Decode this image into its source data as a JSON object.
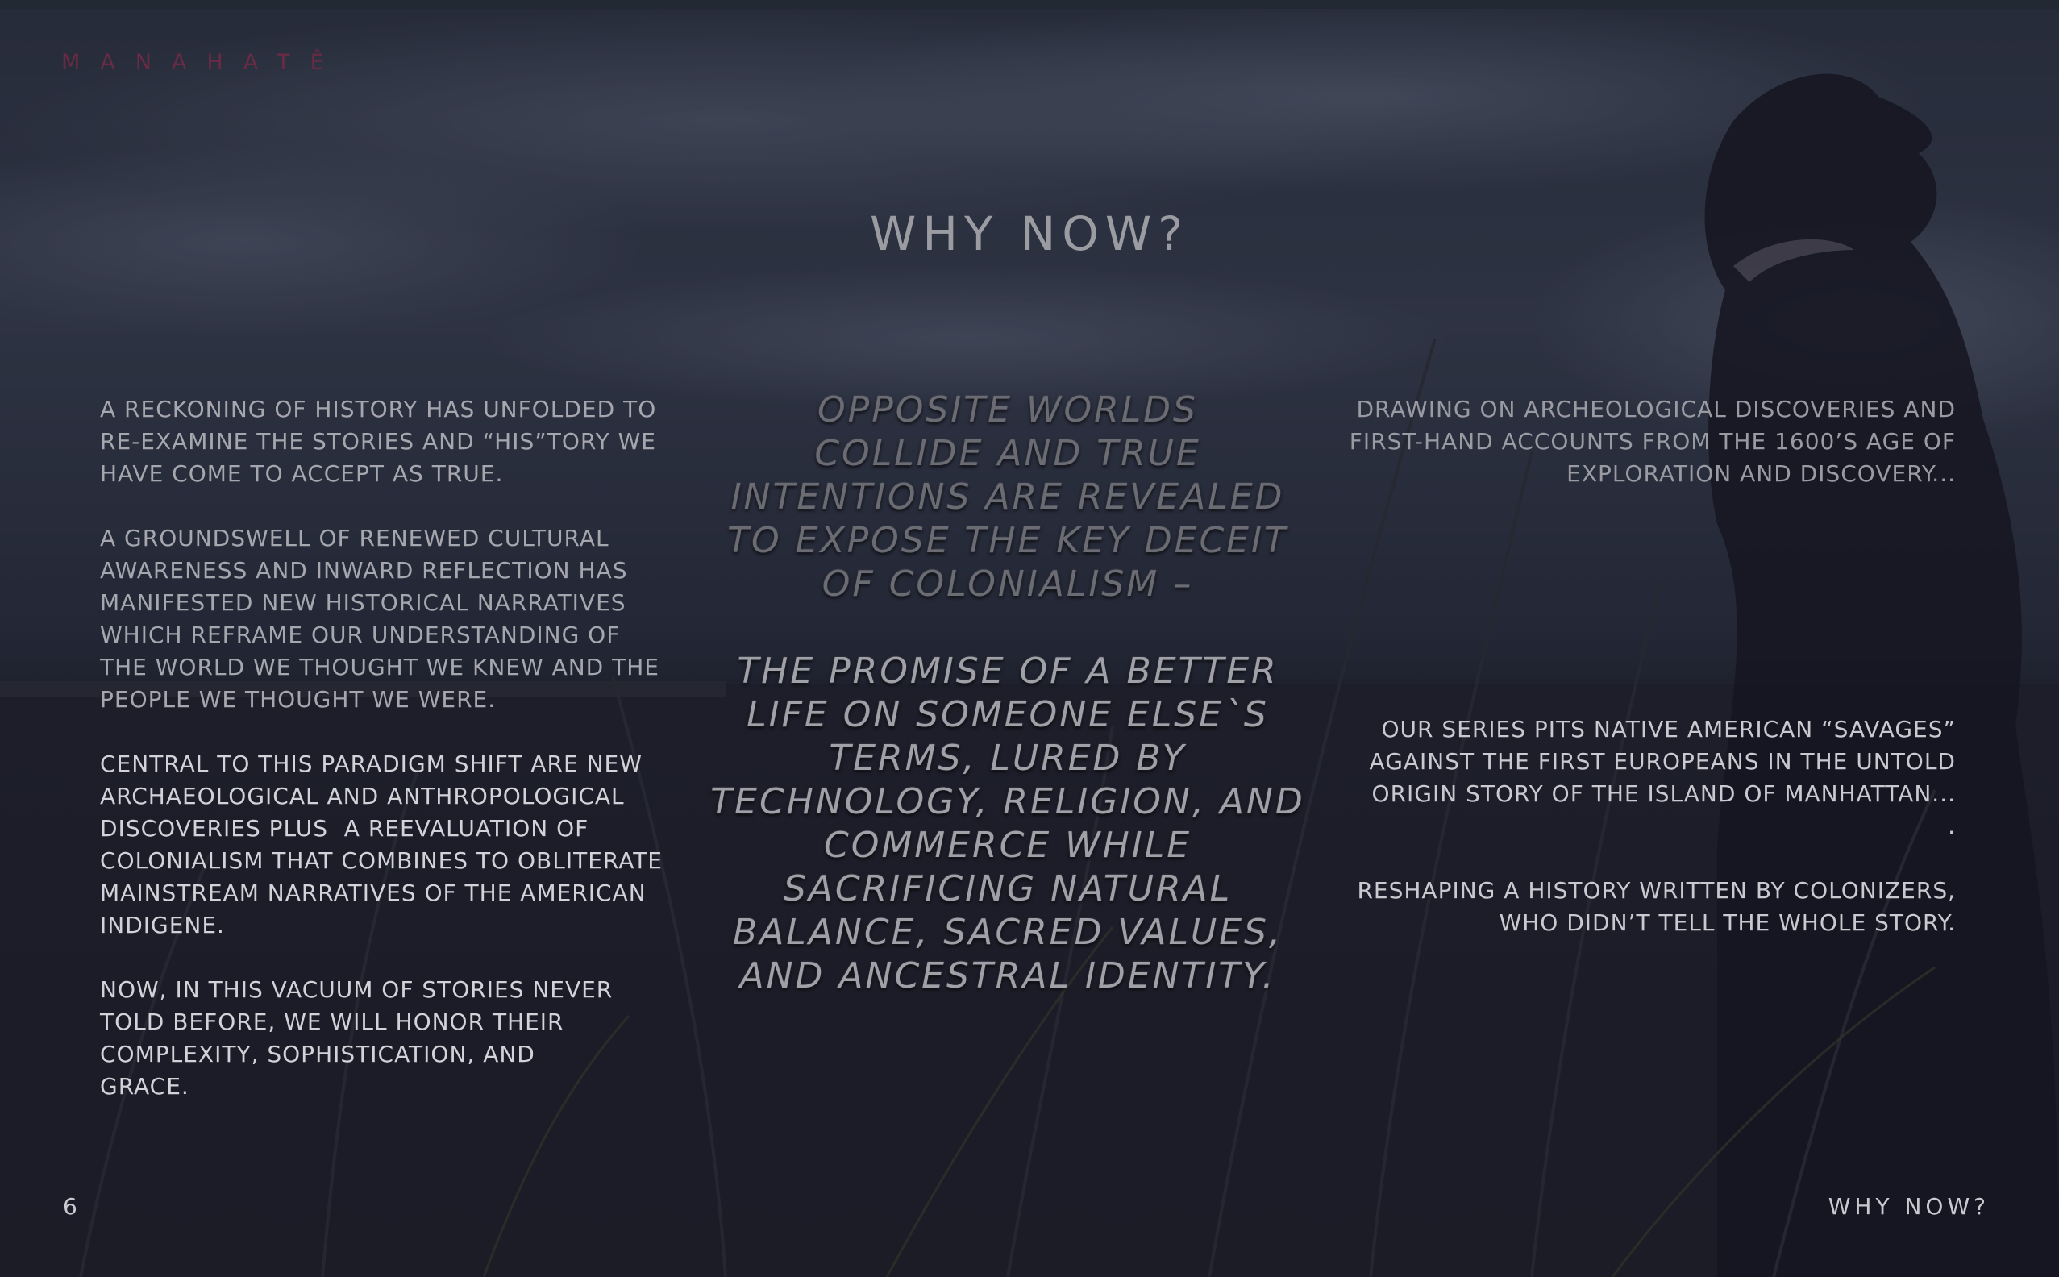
{
  "brand": {
    "name": "MANAHATÊ"
  },
  "page": {
    "title": "WHY NOW?",
    "number": "6",
    "footer_title": "WHY NOW?"
  },
  "left_column": {
    "paragraphs": [
      "A RECKONING OF HISTORY HAS UNFOLDED TO\nRE-EXAMINE THE STORIES AND “HIS”TORY WE\nHAVE COME TO ACCEPT AS TRUE.",
      "A GROUNDSWELL OF RENEWED CULTURAL\nAWARENESS AND INWARD REFLECTION HAS\nMANIFESTED NEW HISTORICAL NARRATIVES\nWHICH REFRAME OUR UNDERSTANDING OF\nTHE WORLD WE THOUGHT WE KNEW AND THE\nPEOPLE WE THOUGHT WE WERE.",
      "CENTRAL TO THIS PARADIGM SHIFT ARE NEW\nARCHAEOLOGICAL AND ANTHROPOLOGICAL\nDISCOVERIES PLUS  A REEVALUATION OF\nCOLONIALISM THAT COMBINES TO OBLITERATE\nMAINSTREAM NARRATIVES OF THE AMERICAN\nINDIGENE.",
      "NOW, IN THIS VACUUM OF STORIES NEVER\nTOLD BEFORE, WE WILL HONOR THEIR\nCOMPLEXITY, SOPHISTICATION, AND\nGRACE."
    ]
  },
  "center_quote": {
    "paragraphs": [
      "OPPOSITE WORLDS\nCOLLIDE AND TRUE\nINTENTIONS ARE REVEALED\nTO EXPOSE THE KEY DECEIT\nOF COLONIALISM –",
      "THE PROMISE OF A BETTER\nLIFE ON SOMEONE ELSE`S\nTERMS, LURED BY\nTECHNOLOGY, RELIGION, AND\nCOMMERCE WHILE\nSACRIFICING NATURAL\nBALANCE, SACRED VALUES,\nAND ANCESTRAL IDENTITY."
    ]
  },
  "right_column": {
    "top_paragraph": "DRAWING ON ARCHEOLOGICAL DISCOVERIES AND\nFIRST-HAND ACCOUNTS FROM THE 1600’S AGE OF\nEXPLORATION AND DISCOVERY...",
    "bottom_paragraphs": [
      "OUR SERIES PITS NATIVE AMERICAN “SAVAGES”\nAGAINST THE FIRST EUROPEANS IN THE UNTOLD\nORIGIN STORY OF THE ISLAND OF MANHATTAN...\n.",
      "RESHAPING A HISTORY WRITTEN BY COLONIZERS,\nWHO DIDN’T TELL THE WHOLE STORY."
    ]
  },
  "colors": {
    "background": "#1b1d26",
    "brand": "#6b2a44",
    "text": "#c9cad0"
  }
}
